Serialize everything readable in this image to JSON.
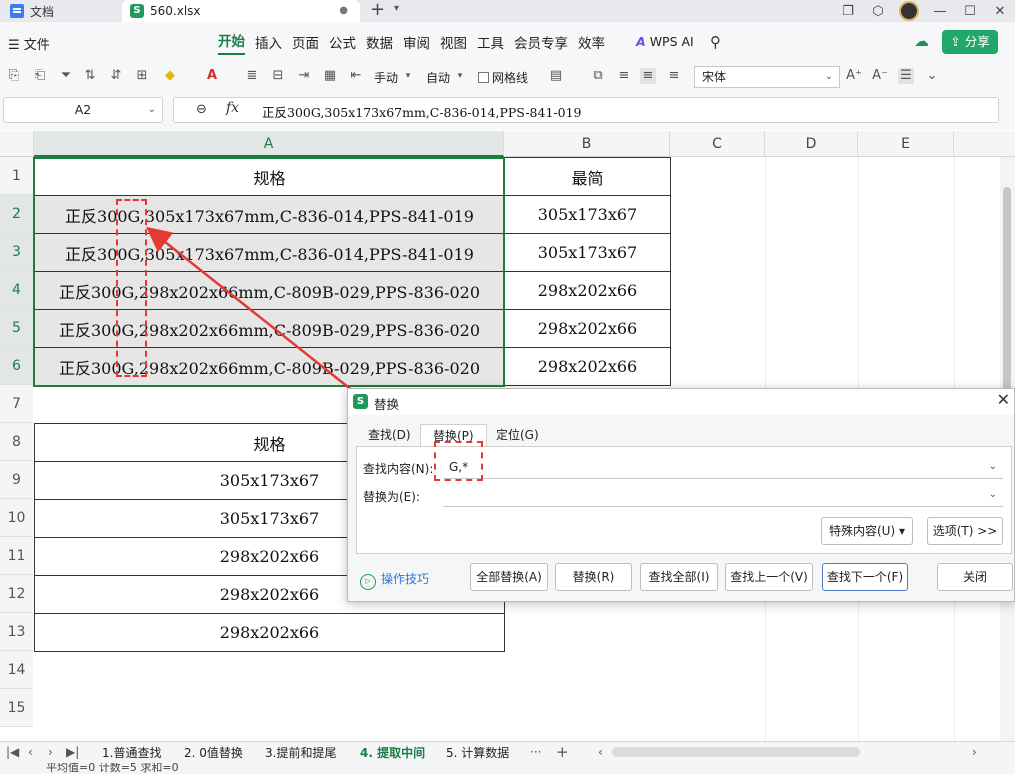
{
  "tabs": {
    "docs_label": "文档",
    "file_label": "560.xlsx"
  },
  "menu": {
    "file": "文件",
    "items": [
      "开始",
      "插入",
      "页面",
      "公式",
      "数据",
      "审阅",
      "视图",
      "工具",
      "会员专享",
      "效率"
    ],
    "wps_ai": "WPS AI",
    "share": "分享"
  },
  "toolbar": {
    "manual": "手动",
    "auto": "自动",
    "gridlines": "网格线",
    "font": "宋体"
  },
  "formula": {
    "cell_ref": "A2",
    "content": "正反300G,305x173x67mm,C-836-014,PPS-841-019"
  },
  "columns": [
    "A",
    "B",
    "C",
    "D",
    "E"
  ],
  "rows": [
    "1",
    "2",
    "3",
    "4",
    "5",
    "6",
    "7",
    "8",
    "9",
    "10",
    "11",
    "12",
    "13",
    "14",
    "15"
  ],
  "sheet": {
    "a1": "规格",
    "b1": "最简",
    "a_data": [
      "正反300G,305x173x67mm,C-836-014,PPS-841-019",
      "正反300G,305x173x67mm,C-836-014,PPS-841-019",
      "正反300G,298x202x66mm,C-809B-029,PPS-836-020",
      "正反300G,298x202x66mm,C-809B-029,PPS-836-020",
      "正反300G,298x202x66mm,C-809B-029,PPS-836-020"
    ],
    "b_data": [
      "305x173x67",
      "305x173x67",
      "298x202x66",
      "298x202x66",
      "298x202x66"
    ],
    "a8": "规格",
    "a_lower": [
      "305x173x67",
      "305x173x67",
      "298x202x66",
      "298x202x66",
      "298x202x66"
    ]
  },
  "dialog": {
    "title": "替换",
    "tabs": [
      "查找(D)",
      "替换(P)",
      "定位(G)"
    ],
    "find_label": "查找内容(N):",
    "find_value": "G,*",
    "replace_label": "替换为(E):",
    "replace_value": "",
    "special": "特殊内容(U)",
    "options": "选项(T) >>",
    "tips": "操作技巧",
    "buttons": [
      "全部替换(A)",
      "替换(R)",
      "查找全部(I)",
      "查找上一个(V)",
      "查找下一个(F)",
      "关闭"
    ]
  },
  "sheet_tabs": [
    "1.普通查找",
    "2. 0值替换",
    "3.提前和提尾",
    "4. 提取中间",
    "5. 计算数据"
  ],
  "status": {
    "text": "平均值=0  计数=5  求和=0"
  },
  "colors": {
    "accent": "#1a7d45",
    "annotation": "#e53935"
  }
}
